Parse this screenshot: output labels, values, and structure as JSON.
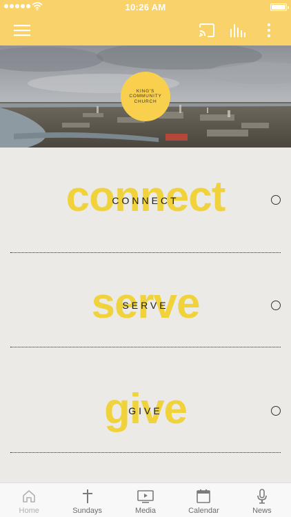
{
  "status_bar": {
    "time": "10:26 AM"
  },
  "hero": {
    "logo_line1": "KING'S",
    "logo_line2": "COMMUNITY",
    "logo_line3": "CHURCH"
  },
  "sections": [
    {
      "big_text": "connect",
      "label": "CONNECT"
    },
    {
      "big_text": "serve",
      "label": "SERVE"
    },
    {
      "big_text": "give",
      "label": "GIVE"
    }
  ],
  "tabbar": {
    "items": [
      {
        "label": "Home",
        "icon": "home-icon"
      },
      {
        "label": "Sundays",
        "icon": "cross-icon"
      },
      {
        "label": "Media",
        "icon": "play-screen-icon"
      },
      {
        "label": "Calendar",
        "icon": "calendar-icon"
      },
      {
        "label": "News",
        "icon": "microphone-icon"
      }
    ]
  },
  "colors": {
    "brand_yellow": "#f9d26a",
    "logo_yellow": "#f9d04e",
    "watermark_yellow": "#f0d33c",
    "background": "#eceae7"
  }
}
